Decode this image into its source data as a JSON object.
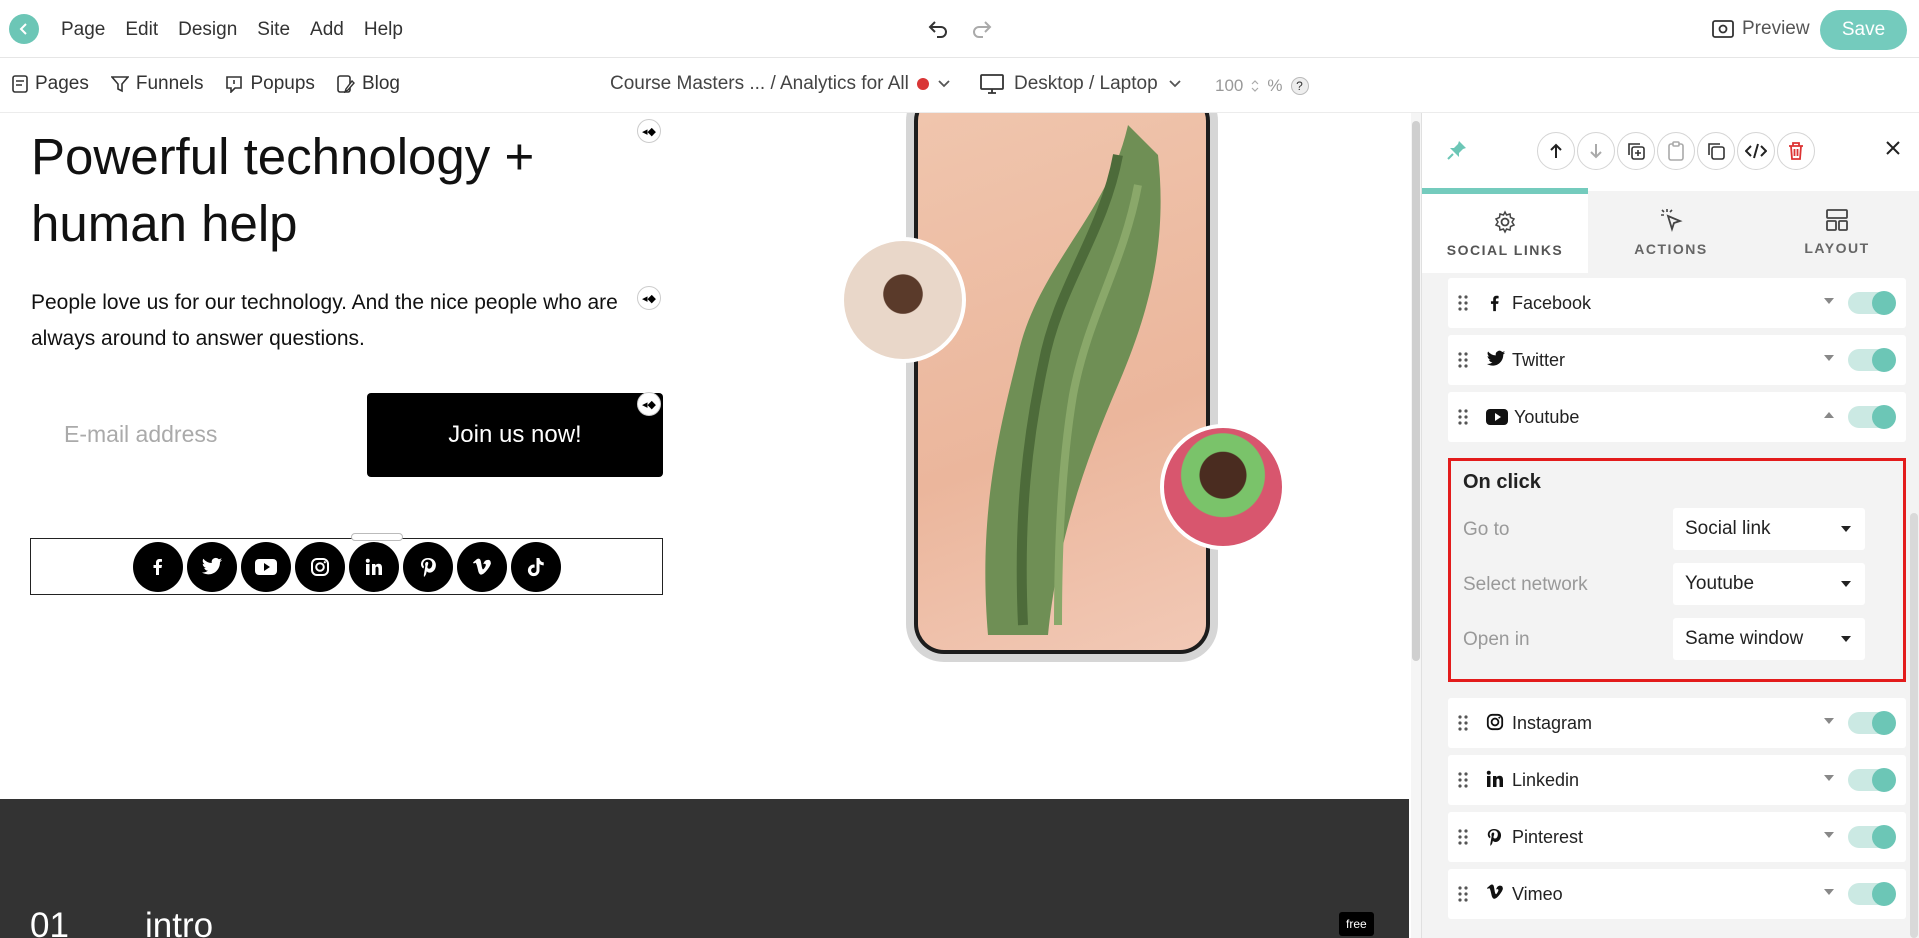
{
  "topbar": {
    "menu": [
      "Page",
      "Edit",
      "Design",
      "Site",
      "Add",
      "Help"
    ],
    "preview_label": "Preview",
    "save_label": "Save"
  },
  "subbar": {
    "nav": [
      "Pages",
      "Funnels",
      "Popups",
      "Blog"
    ],
    "breadcrumb": "Course Masters ... / Analytics for All",
    "device": "Desktop / Laptop",
    "zoom_value": "100",
    "zoom_unit": "%",
    "help_badge": "?"
  },
  "canvas": {
    "headline": "Powerful technology + human help",
    "subtext": "People love us for our technology. And the nice people who are always around to answer questions.",
    "email_placeholder": "E-mail address",
    "join_label": "Join us now!",
    "social_icons": [
      "facebook-icon",
      "twitter-icon",
      "youtube-icon",
      "instagram-icon",
      "linkedin-icon",
      "pinterest-icon",
      "vimeo-icon",
      "tiktok-icon"
    ],
    "section_number": "01",
    "section_title": "intro",
    "free_badge": "free"
  },
  "panel": {
    "tabs": [
      "SOCIAL LINKS",
      "ACTIONS",
      "LAYOUT"
    ],
    "rows_before": [
      {
        "label": "Facebook",
        "icon": "facebook-icon",
        "expanded": false
      },
      {
        "label": "Twitter",
        "icon": "twitter-icon",
        "expanded": false
      },
      {
        "label": "Youtube",
        "icon": "youtube-icon",
        "expanded": true
      }
    ],
    "onclick": {
      "title": "On click",
      "fields": [
        {
          "label": "Go to",
          "value": "Social link"
        },
        {
          "label": "Select network",
          "value": "Youtube"
        },
        {
          "label": "Open in",
          "value": "Same window"
        }
      ]
    },
    "rows_after": [
      {
        "label": "Instagram",
        "icon": "instagram-icon"
      },
      {
        "label": "Linkedin",
        "icon": "linkedin-icon"
      },
      {
        "label": "Pinterest",
        "icon": "pinterest-icon"
      },
      {
        "label": "Vimeo",
        "icon": "vimeo-icon"
      }
    ]
  },
  "colors": {
    "accent": "#74cbbd",
    "highlight_border": "#e31b1b",
    "dark_section": "#333333"
  }
}
